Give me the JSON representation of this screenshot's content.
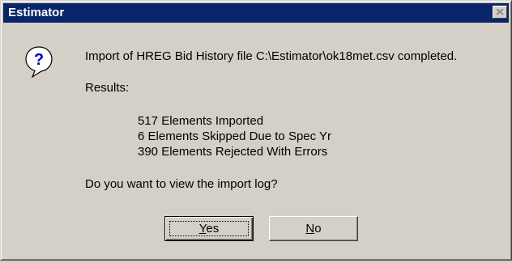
{
  "window": {
    "title": "Estimator"
  },
  "icons": {
    "question": "question-icon",
    "close": "close-icon"
  },
  "message": {
    "line1": "Import of HREG Bid History file C:\\Estimator\\ok18met.csv completed.",
    "results_label": "Results:",
    "results": [
      "517 Elements Imported",
      "6 Elements Skipped Due to Spec Yr",
      "390 Elements Rejected With Errors"
    ],
    "question": "Do you want to view the import log?"
  },
  "buttons": {
    "yes": {
      "mnemonic": "Y",
      "rest": "es"
    },
    "no": {
      "mnemonic": "N",
      "rest": "o"
    }
  },
  "colors": {
    "titlebar": "#0a246a",
    "face": "#d4d0c8"
  }
}
